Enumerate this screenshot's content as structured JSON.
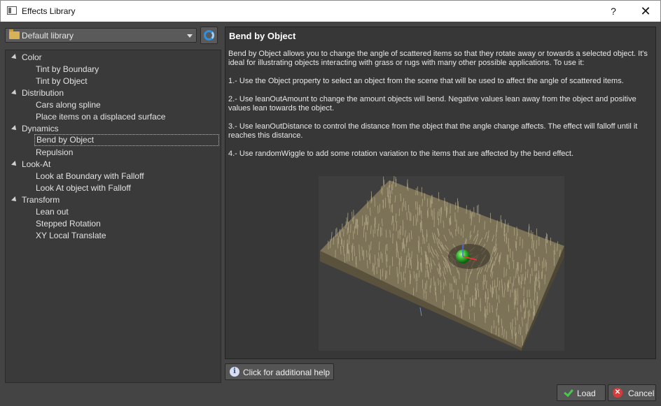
{
  "window": {
    "title": "Effects Library",
    "help": "?",
    "close": "✕"
  },
  "library": {
    "selected": "Default library"
  },
  "tree": [
    {
      "label": "Color",
      "type": "cat"
    },
    {
      "label": "Tint by Boundary",
      "type": "item"
    },
    {
      "label": "Tint by Object",
      "type": "item"
    },
    {
      "label": "Distribution",
      "type": "cat"
    },
    {
      "label": "Cars along spline",
      "type": "item"
    },
    {
      "label": "Place items on a displaced surface",
      "type": "item"
    },
    {
      "label": "Dynamics",
      "type": "cat"
    },
    {
      "label": "Bend by Object",
      "type": "item",
      "selected": true
    },
    {
      "label": "Repulsion",
      "type": "item"
    },
    {
      "label": "Look-At",
      "type": "cat"
    },
    {
      "label": "Look at Boundary with Falloff",
      "type": "item"
    },
    {
      "label": "Look At object with Falloff",
      "type": "item"
    },
    {
      "label": "Transform",
      "type": "cat"
    },
    {
      "label": "Lean out",
      "type": "item"
    },
    {
      "label": "Stepped Rotation",
      "type": "item"
    },
    {
      "label": "XY Local Translate",
      "type": "item"
    }
  ],
  "description": {
    "title": "Bend by Object",
    "paragraphs": [
      "Bend by Object allows you to change the angle of scattered items so that they rotate away or towards a selected object. It's ideal for illustrating objects interacting with grass or rugs with many other possible applications. To use it:",
      "1.- Use the Object property to select an object from the scene that will be used to affect the angle of scattered items.",
      "2.- Use leanOutAmount to change the amount objects will bend. Negative values lean away from the object and positive values lean towards the object.",
      "3.- Use leanOutDistance to control the distance from the object that the angle change affects. The effect will falloff until it reaches this distance.",
      "4.- Use randomWiggle to add some rotation variation to the items that are affected by the bend effect."
    ]
  },
  "buttons": {
    "help": "Click for additional help",
    "load": "Load",
    "cancel": "Cancel"
  },
  "colors": {
    "accent": "#2f8fe0",
    "grass": "#8a7e5e",
    "sphere": "#3bbb3b"
  }
}
